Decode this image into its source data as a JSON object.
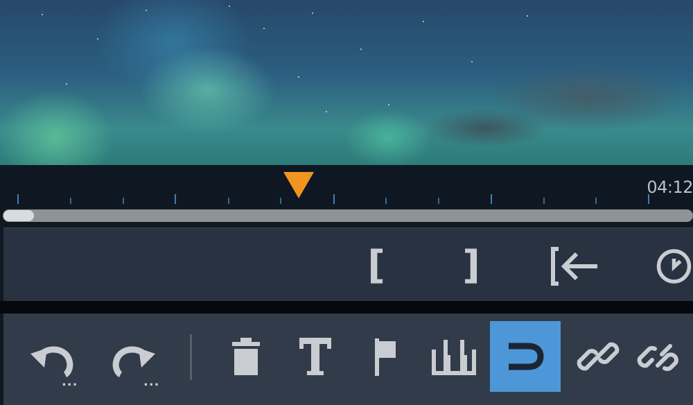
{
  "timeline": {
    "timecode": "04:12"
  },
  "trim_controls": {
    "mark_in": "[",
    "mark_out": "]",
    "go_to_in_icon": "go-to-in-icon",
    "clock_icon": "clock-icon"
  },
  "toolbar": {
    "undo_more": "...",
    "redo_more": "...",
    "icons": [
      "undo-icon",
      "redo-icon",
      "delete-icon",
      "text-icon",
      "marker-icon",
      "split-icon",
      "magnet-icon",
      "link-icon",
      "unlink-icon"
    ]
  },
  "colors": {
    "accent": "#4d97d8",
    "playhead": "#f29420",
    "toolbar_bg": "#323b49"
  }
}
